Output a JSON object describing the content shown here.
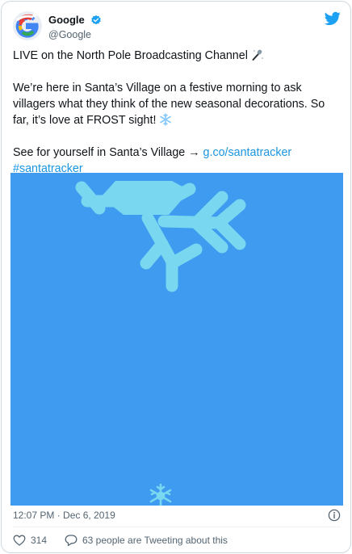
{
  "tweet": {
    "author": {
      "display_name": "Google",
      "handle": "@Google",
      "verified": true,
      "avatar_icon": "google-santa-hat-logo"
    },
    "platform_icon": "twitter-bird-icon",
    "paragraphs": {
      "p1": "LIVE on the North Pole Broadcasting Channel",
      "p1_emoji": "microphone-emoji",
      "p2": "We’re here in Santa’s Village on a festive morning to ask villagers what they think of the new seasonal decorations. So far, it’s love at FROST sight!",
      "p2_emoji": "snowflake-emoji",
      "p3_prefix": "See for yourself in Santa’s Village → ",
      "p3_link": "g.co/santatracker",
      "hashtag": "#santatracker"
    },
    "media": {
      "type": "animated-gif",
      "description_icon": "snowflake-graphic",
      "background_color": "#3f9bef",
      "snowflake_color": "#79d7f0"
    },
    "timestamp": "12:07 PM · Dec 6, 2019",
    "likes": "314",
    "replies_text": "63 people are Tweeting about this",
    "colors": {
      "link": "#1b95e0",
      "verified": "#1da1f2",
      "muted": "#536471"
    }
  }
}
